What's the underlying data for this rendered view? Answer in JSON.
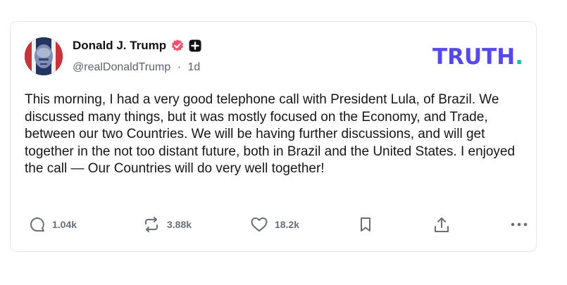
{
  "post": {
    "author_name": "Donald J. Trump",
    "handle": "@realDonaldTrump",
    "separator": "·",
    "age": "1d",
    "body": "This morning, I had a very good telephone call with President Lula, of Brazil. We discussed many things, but it was mostly focused on the Economy, and Trade, between our two Countries. We will be having further discussions, and will get together in the not too distant future, both in Brazil and the United States. I enjoyed the call — Our Countries will do very well together!"
  },
  "brand": {
    "logo_text": "TRUTH",
    "logo_dot": ".",
    "logo_color": "#5448ee",
    "dot_color": "#19c1a3"
  },
  "actions": {
    "replies": "1.04k",
    "retruths": "3.88k",
    "likes": "18.2k"
  },
  "icons": {
    "verified": "verified-badge-icon",
    "plus": "plus-badge-icon",
    "reply": "comment-bubble-icon",
    "retruth": "repost-arrows-icon",
    "like": "heart-icon",
    "bookmark": "bookmark-icon",
    "share": "share-upload-icon",
    "more": "more-dots-icon"
  },
  "colors": {
    "verified_badge": "#f2506e",
    "action_gray": "#6b6e78"
  }
}
